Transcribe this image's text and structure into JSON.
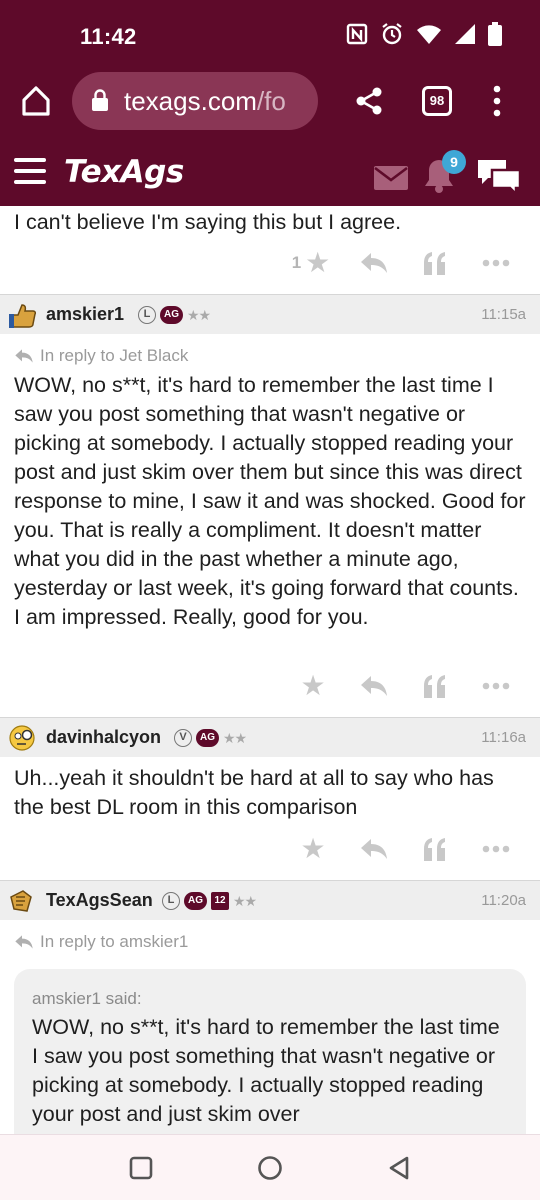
{
  "status_bar": {
    "time": "11:42"
  },
  "browser": {
    "url_main": "texags.com",
    "url_dim": "/fo",
    "tab_count": "98"
  },
  "site": {
    "logo": "TexAgs",
    "notification_count": "9"
  },
  "prev_post": {
    "text": "I can't believe I'm saying this but I agree.",
    "like_count": "1"
  },
  "posts": [
    {
      "username": "amskier1",
      "time": "11:15a",
      "reply_to": "In reply to Jet Black",
      "text": "WOW, no s**t, it's hard to remember the last time I saw you post something that wasn't negative or picking at somebody. I actually stopped reading your post and just skim over them but since this was direct response to mine, I saw it and was shocked. Good for you. That is really a compliment. It doesn't matter what you did in the past whether a minute ago, yesterday or last week, it's going forward that counts. I am impressed. Really, good for you.",
      "badges": {
        "l": "L",
        "ag": "AG",
        "stars": "★★"
      }
    },
    {
      "username": "davinhalcyon",
      "time": "11:16a",
      "text": "Uh...yeah it shouldn't be hard at all to say who has the best DL room in this comparison",
      "badges": {
        "v": "V",
        "ag": "AG",
        "stars": "★★"
      }
    },
    {
      "username": "TexAgsSean",
      "time": "11:20a",
      "reply_to": "In reply to amskier1",
      "quote_name": "amskier1 said:",
      "quote_text": "WOW, no s**t, it's hard to remember the last time I saw you post something that wasn't negative or picking at somebody. I actually stopped reading your post and just skim over",
      "badges": {
        "l": "L",
        "ag": "AG",
        "twelve": "12",
        "stars": "★★"
      }
    }
  ],
  "colors": {
    "maroon": "#5e0a2a",
    "badge_blue": "#3fa7d6",
    "icon_gray": "#c8c8c8"
  }
}
